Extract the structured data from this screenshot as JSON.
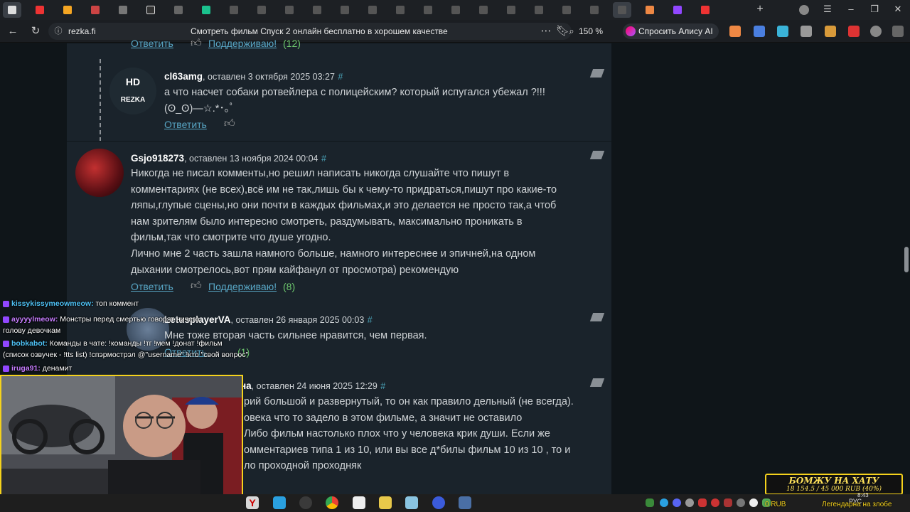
{
  "browser": {
    "domain": "rezka.fi",
    "page_title": "Смотреть фильм Спуск 2 онлайн бесплатно в хорошем качестве",
    "zoom": "150 %",
    "alice_label": "Спросить Алису AI"
  },
  "comments": {
    "top": {
      "reply_label": "Ответить",
      "support_label": "Поддерживаю!",
      "count": "(12)"
    },
    "c1": {
      "avatar_line1": "HD",
      "avatar_line2": "REZKA",
      "username": "cl63amg",
      "meta": ", оставлен 3 октября 2025 03:27",
      "hash": "#",
      "text_line1": "а что насчет собаки ротвейлера с полицейским? который испугался убежал ?!!!",
      "text_line2": "(ʘ_ʘ)—☆.*･｡ﾟ",
      "reply_label": "Ответить"
    },
    "c2": {
      "username": "Gsjo918273",
      "meta": ", оставлен 13 ноября 2024 00:04",
      "hash": "#",
      "lines": [
        "Никогда не писал комменты,но решил написать никогда слушайте что пишут в",
        "комментариях (не всех),всё им не так,лишь бы к чему-то придраться,пишут про какие-то",
        "ляпы,глупые сцены,но они почти в каждых фильмах,и это делается не просто так,а чтоб",
        "нам зрителям было интересно смотреть, раздумывать, максимально проникать в",
        "фильм,так что смотрите что душе угодно.",
        "Лично мне 2 часть зашла намного больше, намного интереснее и эпичней,на одном",
        "дыхании смотрелось,вот прям кайфанул от просмотра) рекомендую"
      ],
      "reply_label": "Ответить",
      "support_label": "Поддерживаю!",
      "count": "(8)"
    },
    "c3": {
      "username": "LetusplayerVA",
      "meta": ", оставлен 26 января 2025 00:03",
      "hash": "#",
      "text": "Мне тоже вторая часть сильнее нравится, чем первая.",
      "reply_label": "Ответить",
      "count": "(1)"
    },
    "c4": {
      "username_tail": "на",
      "meta": ", оставлен 24 июня 2025 12:29",
      "hash": "#",
      "lines": [
        "рий большой и развернутый, то он как правило дельный (не всегда).",
        "овека что то задело в этом фильме, а значит не оставило",
        "Либо фильм настолько плох что у человека крик души. Если же",
        "омментариев типа 1 из 10, или вы все д*билы фильм 10 из 10 , то и",
        "ло проходной проходняк"
      ]
    }
  },
  "chat": [
    {
      "name": "kissykissymeowmeow:",
      "name_color": "#4fc3f7",
      "text": " топ коммент"
    },
    {
      "name": "ayyyylmeow:",
      "name_color": "#c77dff",
      "text": " Монстры перед смертью говорят ничего"
    },
    {
      "name": "",
      "name_color": "#ffffff",
      "text": "голову девочкам"
    },
    {
      "name": "bobkabot:",
      "name_color": "#4fc3f7",
      "text": " Команды в чате: !команды !тг !мем !донат !фильм"
    },
    {
      "name": "",
      "name_color": "#ffffff",
      "text": "(список озвучек - !tts list) !спэрмострэл @\"username\" !кто \"свой вопрос\""
    },
    {
      "name": "iruga91:",
      "name_color": "#c77dff",
      "text": " денамит"
    }
  ],
  "overlay": {
    "donation_title": "БОМЖУ НА ХАТУ",
    "donation_amount": "18 154.5 / 45 000 RUB (40%)",
    "donation_progress": 0.4,
    "bottom_left": "0 RUB",
    "bottom_right": "Легендарна на злобе"
  },
  "taskbar": {
    "lang": "РУС",
    "time": "8:43"
  },
  "colors": {
    "link": "#58a6c5",
    "count_green": "#6ec96e",
    "overlay_yellow": "#f5d21c",
    "content_bg": "#1a232b"
  }
}
